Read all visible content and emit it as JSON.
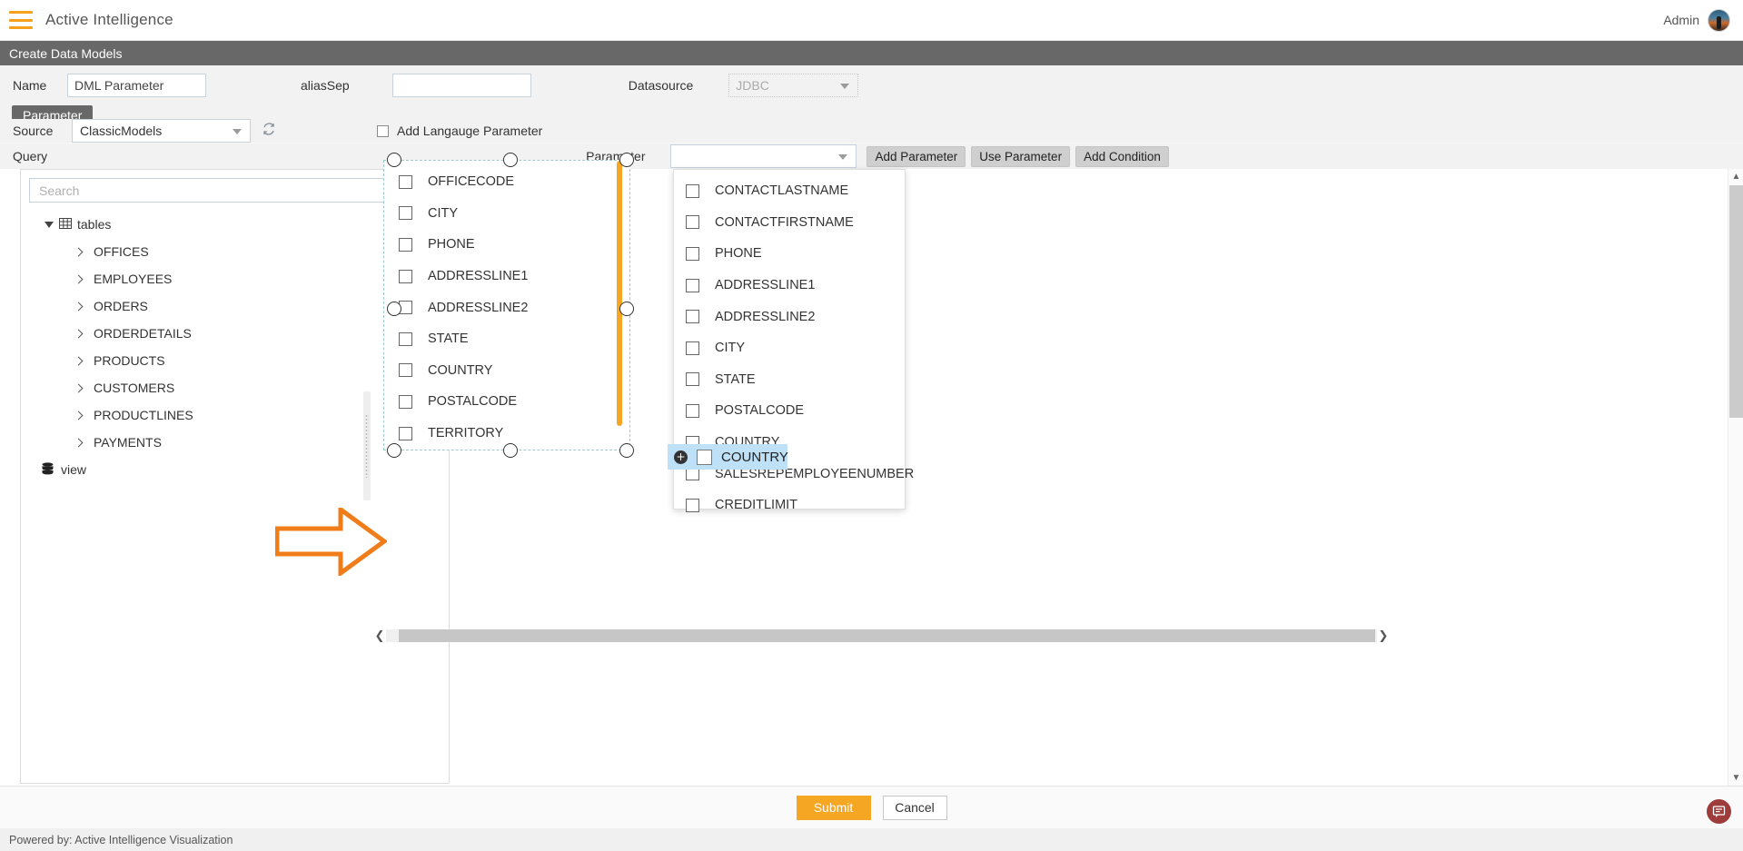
{
  "topbar": {
    "menu_icon": "hamburger-icon",
    "app_title": "Active Intelligence",
    "user_label": "Admin",
    "avatar_icon": "user-avatar"
  },
  "page": {
    "band_title": "Create Data Models"
  },
  "form": {
    "name_label": "Name",
    "name_value": "DML Parameter",
    "aliassep_label": "aliasSep",
    "aliassep_value": "",
    "aliassep_placeholder": "",
    "datasource_label": "Datasource",
    "datasource_value": "JDBC"
  },
  "tabs": [
    {
      "label": "Parameter",
      "active": true
    }
  ],
  "source_row": {
    "source_label": "Source",
    "source_value": "ClassicModels",
    "refresh_icon": "refresh-icon",
    "language_checkbox_label": "Add Langauge Parameter",
    "language_checked": false
  },
  "query_row": {
    "query_label": "Query",
    "parameter_label": "Parameter",
    "parameter_value": "",
    "buttons": [
      {
        "label": "Add Parameter"
      },
      {
        "label": "Use Parameter"
      },
      {
        "label": "Add Condition"
      }
    ]
  },
  "tree_panel": {
    "search_placeholder": "Search",
    "search_value": "",
    "search_icon": "search-icon",
    "root": {
      "label": "tables",
      "icon": "table-grid-icon",
      "expanded": true
    },
    "children": [
      {
        "label": "OFFICES"
      },
      {
        "label": "EMPLOYEES"
      },
      {
        "label": "ORDERS"
      },
      {
        "label": "ORDERDETAILS"
      },
      {
        "label": "PRODUCTS"
      },
      {
        "label": "CUSTOMERS"
      },
      {
        "label": "PRODUCTLINES"
      },
      {
        "label": "PAYMENTS"
      }
    ],
    "view": {
      "label": "view",
      "icon": "database-icon"
    }
  },
  "center_panel": {
    "fields": [
      {
        "label": "OFFICECODE",
        "checked": false
      },
      {
        "label": "CITY",
        "checked": false
      },
      {
        "label": "PHONE",
        "checked": false
      },
      {
        "label": "ADDRESSLINE1",
        "checked": false
      },
      {
        "label": "ADDRESSLINE2",
        "checked": false
      },
      {
        "label": "STATE",
        "checked": false
      },
      {
        "label": "COUNTRY",
        "checked": false
      },
      {
        "label": "POSTALCODE",
        "checked": false
      },
      {
        "label": "TERRITORY",
        "checked": false
      }
    ],
    "scrollbar_color": "#f5a623"
  },
  "popup_panel": {
    "fields": [
      {
        "label": "CONTACTLASTNAME",
        "checked": false
      },
      {
        "label": "CONTACTFIRSTNAME",
        "checked": false
      },
      {
        "label": "PHONE",
        "checked": false
      },
      {
        "label": "ADDRESSLINE1",
        "checked": false
      },
      {
        "label": "ADDRESSLINE2",
        "checked": false
      },
      {
        "label": "CITY",
        "checked": false
      },
      {
        "label": "STATE",
        "checked": false
      },
      {
        "label": "POSTALCODE",
        "checked": false
      },
      {
        "label": "COUNTRY",
        "checked": false
      },
      {
        "label": "SALESREPEMPLOYEENUMBER",
        "checked": false
      },
      {
        "label": "CREDITLIMIT",
        "checked": false
      }
    ]
  },
  "drag_ghost": {
    "label": "COUNTRY",
    "badge_icon": "plus-circle-icon",
    "highlight_color": "#bfe1f7"
  },
  "annotation": {
    "arrow_icon": "right-arrow-annotation",
    "arrow_color": "#f07d1a"
  },
  "actions": {
    "submit_label": "Submit",
    "cancel_label": "Cancel",
    "submit_color": "#f5a623"
  },
  "footer": {
    "text": "Powered by: Active Intelligence Visualization"
  },
  "chat_fab": {
    "icon": "chat-bubble-icon",
    "color": "#9e3b3b"
  }
}
